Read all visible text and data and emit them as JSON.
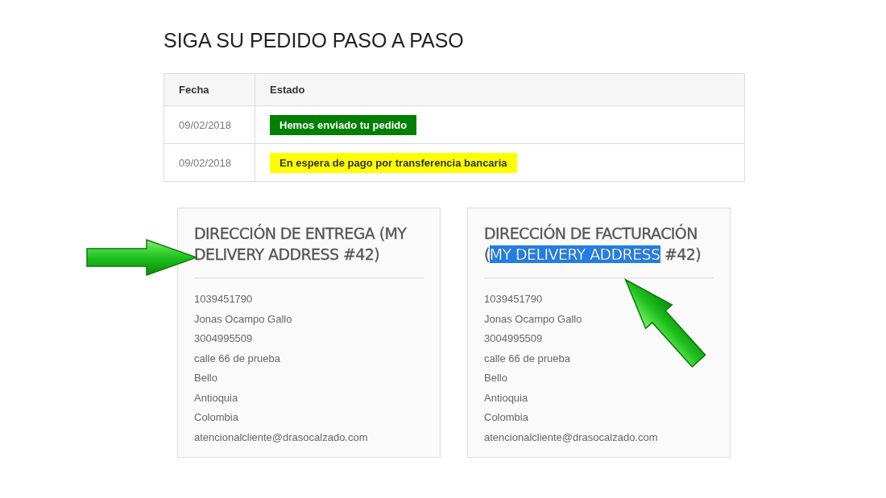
{
  "heading": "SIGA SU PEDIDO PASO A PASO",
  "table": {
    "columns": [
      "Fecha",
      "Estado"
    ],
    "rows": [
      {
        "date": "09/02/2018",
        "status": "Hemos enviado tu pedido",
        "color": "#008000"
      },
      {
        "date": "09/02/2018",
        "status": "En espera de pago por transferencia bancaria",
        "color": "#ffff00"
      }
    ]
  },
  "addresses": [
    {
      "title": [
        {
          "text": "DIRECCIÓN DE ENTREGA (MY DELIVERY ADDRESS #42)",
          "highlighted": false
        }
      ],
      "lines": [
        "1039451790",
        "Jonas Ocampo Gallo",
        "3004995509",
        "calle 66 de prueba",
        "Bello",
        "Antioquia",
        "Colombia",
        "atencionalcliente@drasocalzado.com"
      ]
    },
    {
      "title": [
        {
          "text": "DIRECCIÓN DE FACTURACIÓN (",
          "highlighted": false
        },
        {
          "text": "MY DELIVERY ADDRESS",
          "highlighted": true
        },
        {
          "text": " #42)",
          "highlighted": false
        }
      ],
      "lines": [
        "1039451790",
        "Jonas Ocampo Gallo",
        "3004995509",
        "calle 66 de prueba",
        "Bello",
        "Antioquia",
        "Colombia",
        "atencionalcliente@drasocalzado.com"
      ]
    }
  ]
}
